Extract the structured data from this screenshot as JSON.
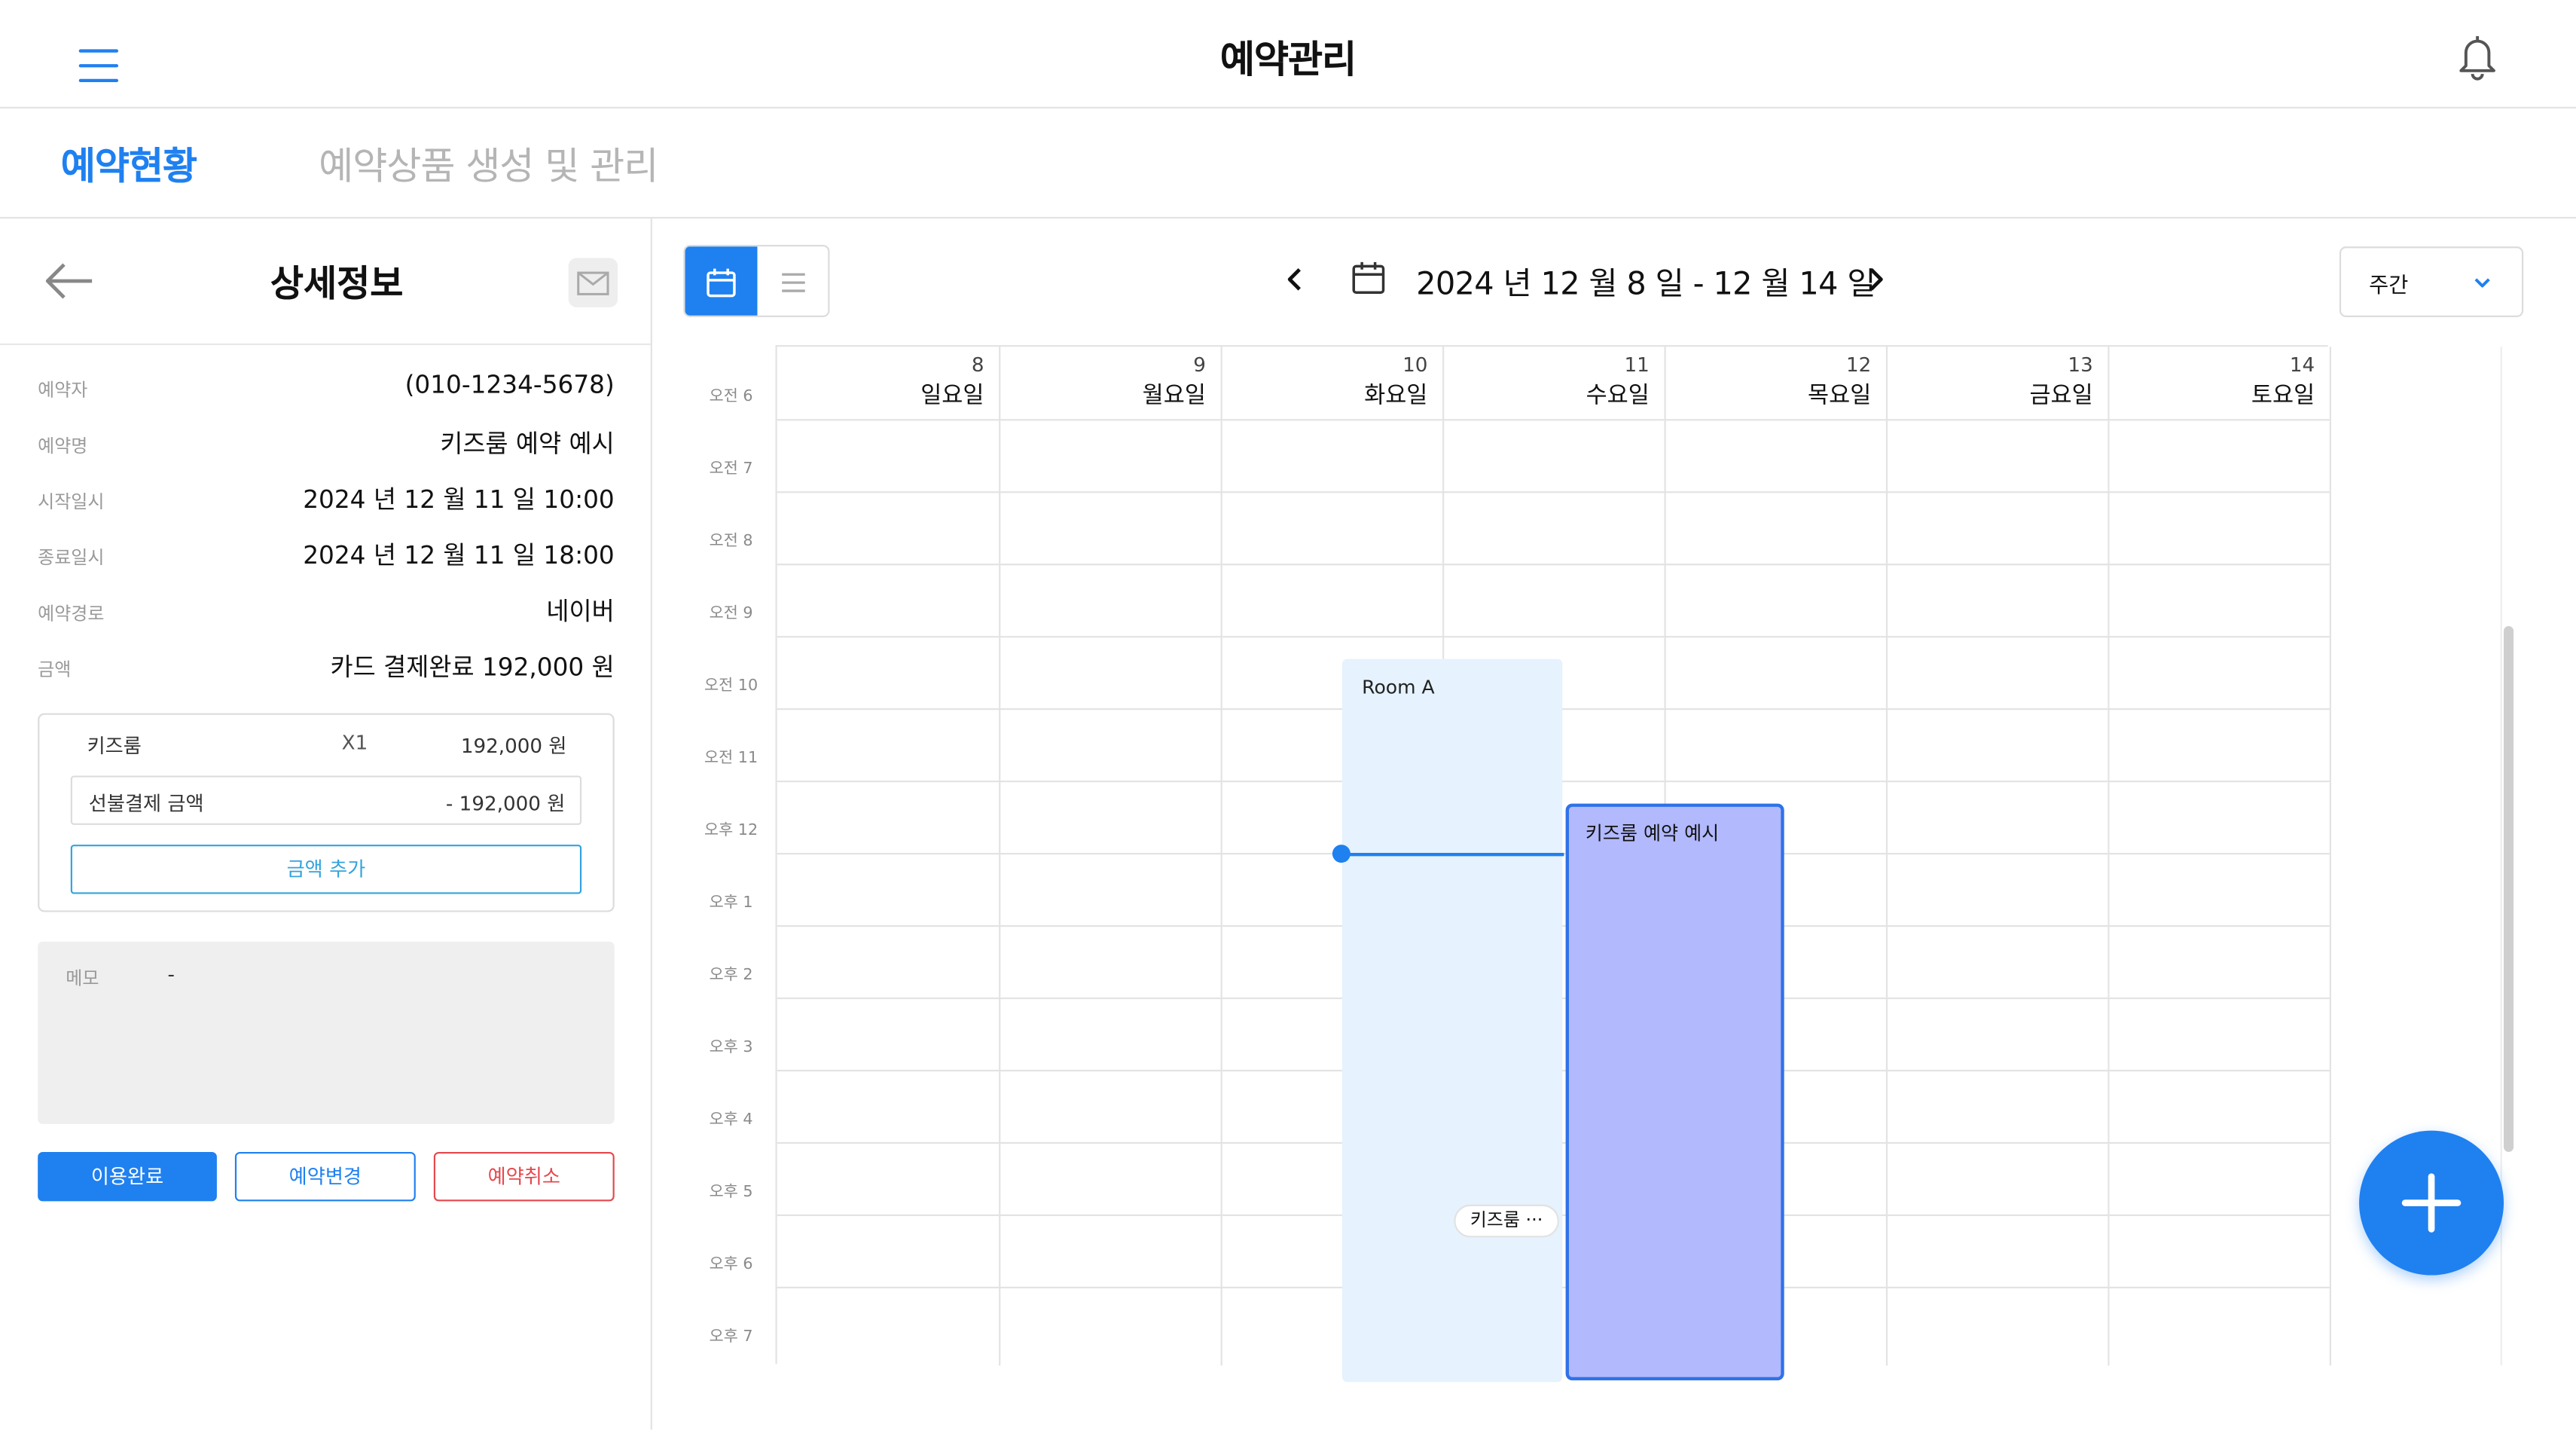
{
  "header": {
    "title": "예약관리"
  },
  "tabs": [
    {
      "label": "예약현황"
    },
    {
      "label": "예약상품 생성 및 관리"
    }
  ],
  "detail": {
    "title": "상세정보",
    "fields": [
      {
        "label": "예약자",
        "value": "(010-1234-5678)"
      },
      {
        "label": "예약명",
        "value": "키즈룸 예약 예시"
      },
      {
        "label": "시작일시",
        "value": "2024 년 12 월 11 일 10:00"
      },
      {
        "label": "종료일시",
        "value": "2024 년 12 월 11 일 18:00"
      },
      {
        "label": "예약경로",
        "value": "네이버"
      },
      {
        "label": "금액",
        "value": "카드 결제완료  192,000 원"
      }
    ],
    "payment": {
      "item_name": "키즈룸",
      "item_qty": "X1",
      "item_price": "192,000 원",
      "prepay_label": "선불결제 금액",
      "prepay_value": "- 192,000 원",
      "add_label": "금액 추가"
    },
    "memo": {
      "label": "메모",
      "value": "-"
    },
    "actions": {
      "done": "이용완료",
      "change": "예약변경",
      "cancel": "예약취소"
    }
  },
  "calendar": {
    "date_range": "2024 년  12 월  8 일 - 12 월  14 일",
    "period": "주간",
    "days": [
      {
        "num": "8",
        "name": "일요일"
      },
      {
        "num": "9",
        "name": "월요일"
      },
      {
        "num": "10",
        "name": "화요일"
      },
      {
        "num": "11",
        "name": "수요일"
      },
      {
        "num": "12",
        "name": "목요일"
      },
      {
        "num": "13",
        "name": "금요일"
      },
      {
        "num": "14",
        "name": "토요일"
      }
    ],
    "hours": [
      "오전 6",
      "오전 7",
      "오전 8",
      "오전 9",
      "오전 10",
      "오전 11",
      "오후 12",
      "오후 1",
      "오후 2",
      "오후 3",
      "오후 4",
      "오후 5",
      "오후 6",
      "오후 7"
    ],
    "room_label": "Room A",
    "event_label": "키즈룸 예약 예시",
    "chip_label": "키즈룸 ···"
  },
  "colors": {
    "accent": "#1f80f0",
    "event": "#b2b9fd",
    "room": "#e6f2fd",
    "danger": "#e5484d"
  }
}
